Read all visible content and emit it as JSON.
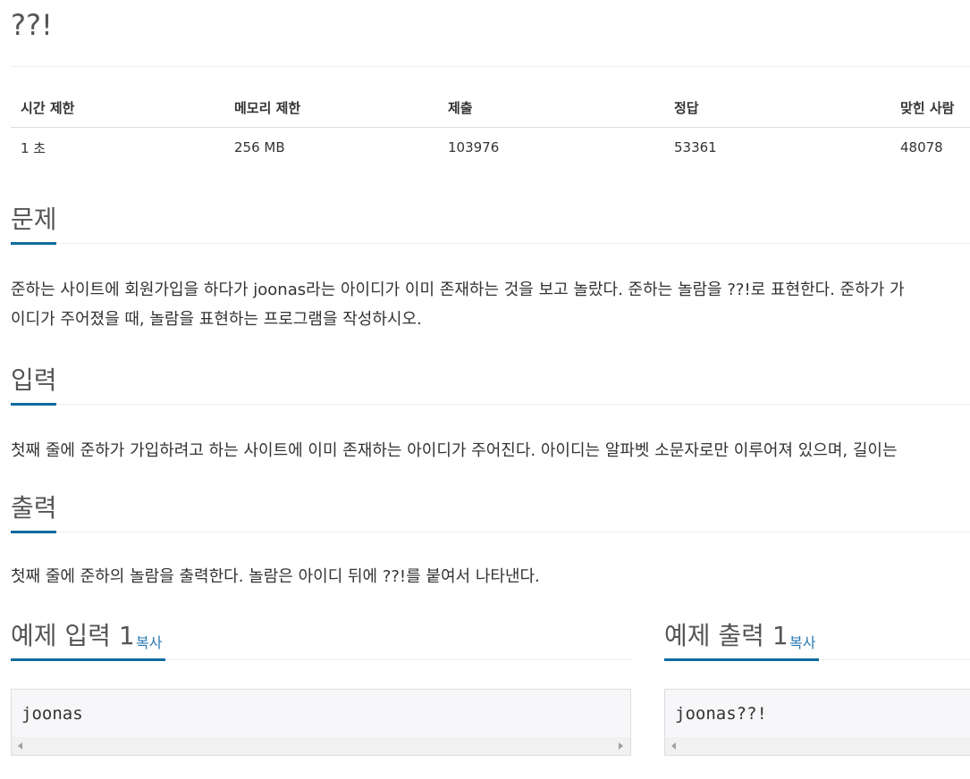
{
  "problem": {
    "title": "??!"
  },
  "info_table": {
    "headers": [
      "시간 제한",
      "메모리 제한",
      "제출",
      "정답",
      "맞힌 사람"
    ],
    "values": [
      "1 초",
      "256 MB",
      "103976",
      "53361",
      "48078"
    ]
  },
  "sections": {
    "problem": {
      "title": "문제",
      "lines": [
        "준하는 사이트에 회원가입을 하다가 joonas라는 아이디가 이미 존재하는 것을 보고 놀랐다. 준하는 놀람을 ??!로 표현한다. 준하가 가",
        "이디가 주어졌을 때, 놀람을 표현하는 프로그램을 작성하시오."
      ]
    },
    "input": {
      "title": "입력",
      "lines": [
        "첫째 줄에 준하가 가입하려고 하는 사이트에 이미 존재하는 아이디가 주어진다. 아이디는 알파벳 소문자로만 이루어져 있으며, 길이는"
      ]
    },
    "output": {
      "title": "출력",
      "lines": [
        "첫째 줄에 준하의 놀람을 출력한다. 놀람은 아이디 뒤에 ??!를 붙여서 나타낸다."
      ]
    }
  },
  "samples": {
    "input": {
      "title": "예제 입력 1",
      "copy_label": "복사",
      "code": "joonas"
    },
    "output": {
      "title": "예제 출력 1",
      "copy_label": "복사",
      "code": "joonas??!"
    }
  },
  "colors": {
    "accent": "#0e6ba0",
    "link": "#2a7ab0",
    "code_bg": "#f7f7f9"
  }
}
